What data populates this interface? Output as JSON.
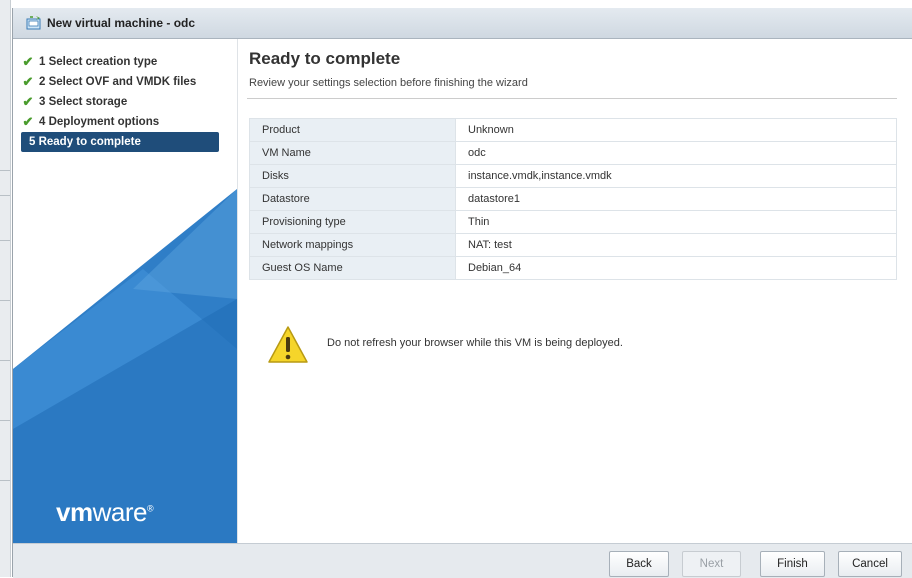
{
  "window": {
    "title": "New virtual machine - odc"
  },
  "steps": [
    {
      "label": "1 Select creation type",
      "done": true
    },
    {
      "label": "2 Select OVF and VMDK files",
      "done": true
    },
    {
      "label": "3 Select storage",
      "done": true
    },
    {
      "label": "4 Deployment options",
      "done": true
    },
    {
      "label": "5 Ready to complete",
      "active": true
    }
  ],
  "branding": {
    "logo_vm": "vm",
    "logo_ware": "ware",
    "logo_mark": "®"
  },
  "main": {
    "heading": "Ready to complete",
    "subheading": "Review your settings selection before finishing the wizard",
    "summary": [
      {
        "key": "Product",
        "value": "Unknown"
      },
      {
        "key": "VM Name",
        "value": "odc"
      },
      {
        "key": "Disks",
        "value": "instance.vmdk,instance.vmdk"
      },
      {
        "key": "Datastore",
        "value": "datastore1"
      },
      {
        "key": "Provisioning type",
        "value": "Thin"
      },
      {
        "key": "Network mappings",
        "value": "NAT: test"
      },
      {
        "key": "Guest OS Name",
        "value": "Debian_64"
      }
    ],
    "warning": "Do not refresh your browser while this VM is being deployed."
  },
  "footer": {
    "back": "Back",
    "next": "Next",
    "finish": "Finish",
    "cancel": "Cancel"
  },
  "icons": {
    "check": "check-icon",
    "warning": "warning-icon",
    "vm": "new-vm-icon"
  },
  "colors": {
    "active_step": "#1f4d7a",
    "check": "#4a9c2d",
    "sidebar_blue": "#2f7ec7"
  }
}
